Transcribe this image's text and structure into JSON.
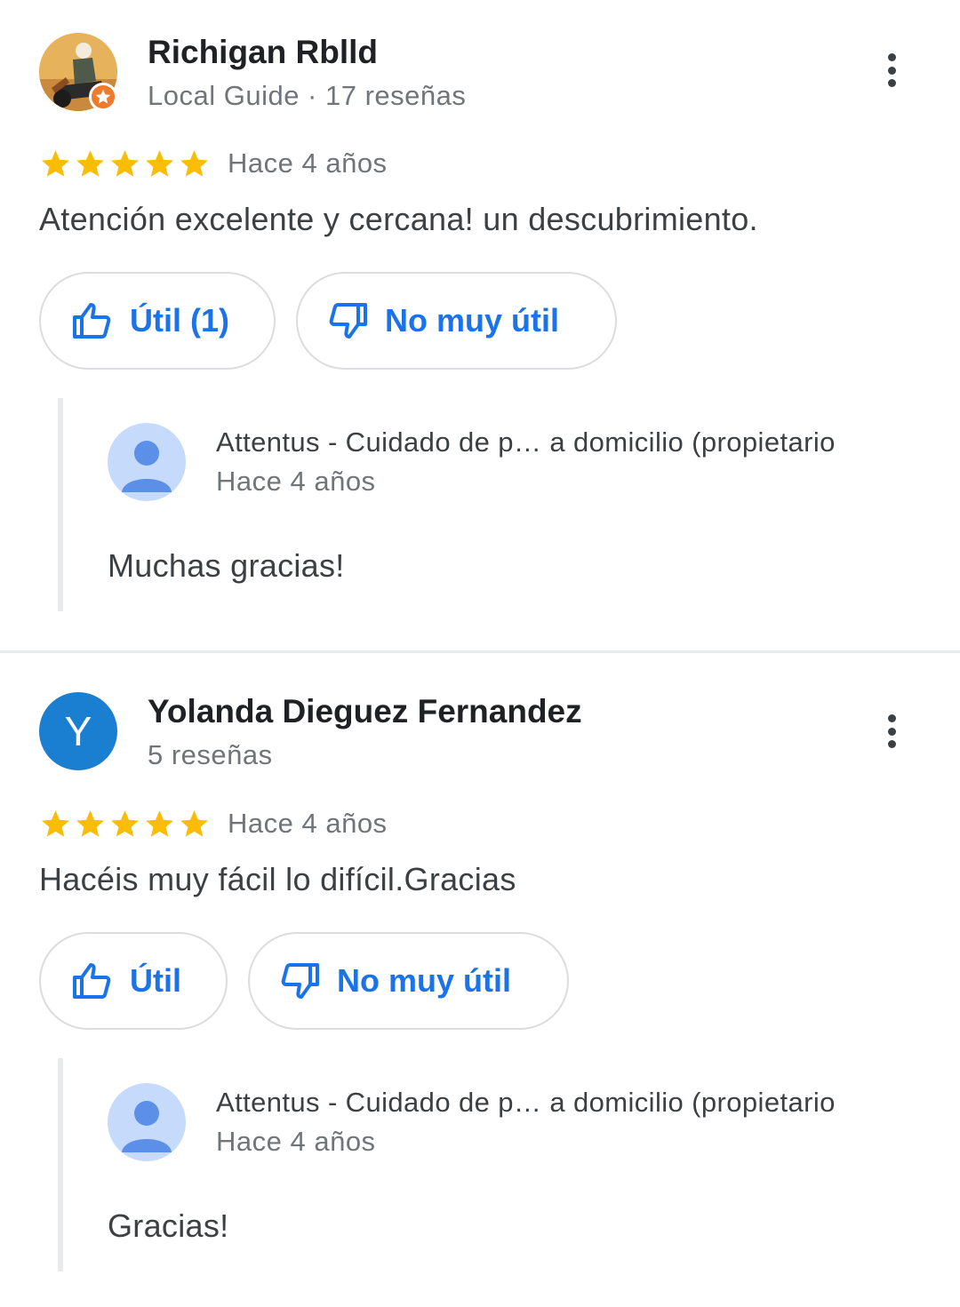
{
  "reviews": [
    {
      "author": "Richigan Rblld",
      "meta": "Local Guide · 17 reseñas",
      "avatar_type": "photo",
      "local_guide_badge": true,
      "rating": 5,
      "date": "Hace 4 años",
      "text": "Atención excelente y cercana! un descubrimiento.",
      "helpful_label": "Útil (1)",
      "unhelpful_label": "No muy útil",
      "reply": {
        "owner": "Attentus - Cuidado de p…   a domicilio (propietario",
        "date": "Hace 4 años",
        "text": "Muchas gracias!"
      }
    },
    {
      "author": "Yolanda Dieguez Fernandez",
      "meta": "5 reseñas",
      "avatar_type": "letter",
      "avatar_letter": "Y",
      "rating": 5,
      "date": "Hace 4 años",
      "text": "Hacéis muy fácil lo difícil.Gracias",
      "helpful_label": "Útil",
      "unhelpful_label": "No muy útil",
      "reply": {
        "owner": "Attentus - Cuidado de p…   a domicilio (propietario",
        "date": "Hace 4 años",
        "text": "Gracias!"
      }
    }
  ],
  "colors": {
    "star": "#fbbc04",
    "accent": "#1a73e8",
    "letter_avatar": "#1a7fd0",
    "owner_avatar_bg": "#c6dafc",
    "owner_avatar_fg": "#5b8fe8",
    "guide_badge": "#f07a2b"
  },
  "icons": {
    "more": "more-vert-icon",
    "helpful": "thumb-up-icon",
    "unhelpful": "thumb-down-icon",
    "star": "star-icon",
    "guide": "local-guide-badge-icon",
    "owner_avatar": "person-icon"
  }
}
